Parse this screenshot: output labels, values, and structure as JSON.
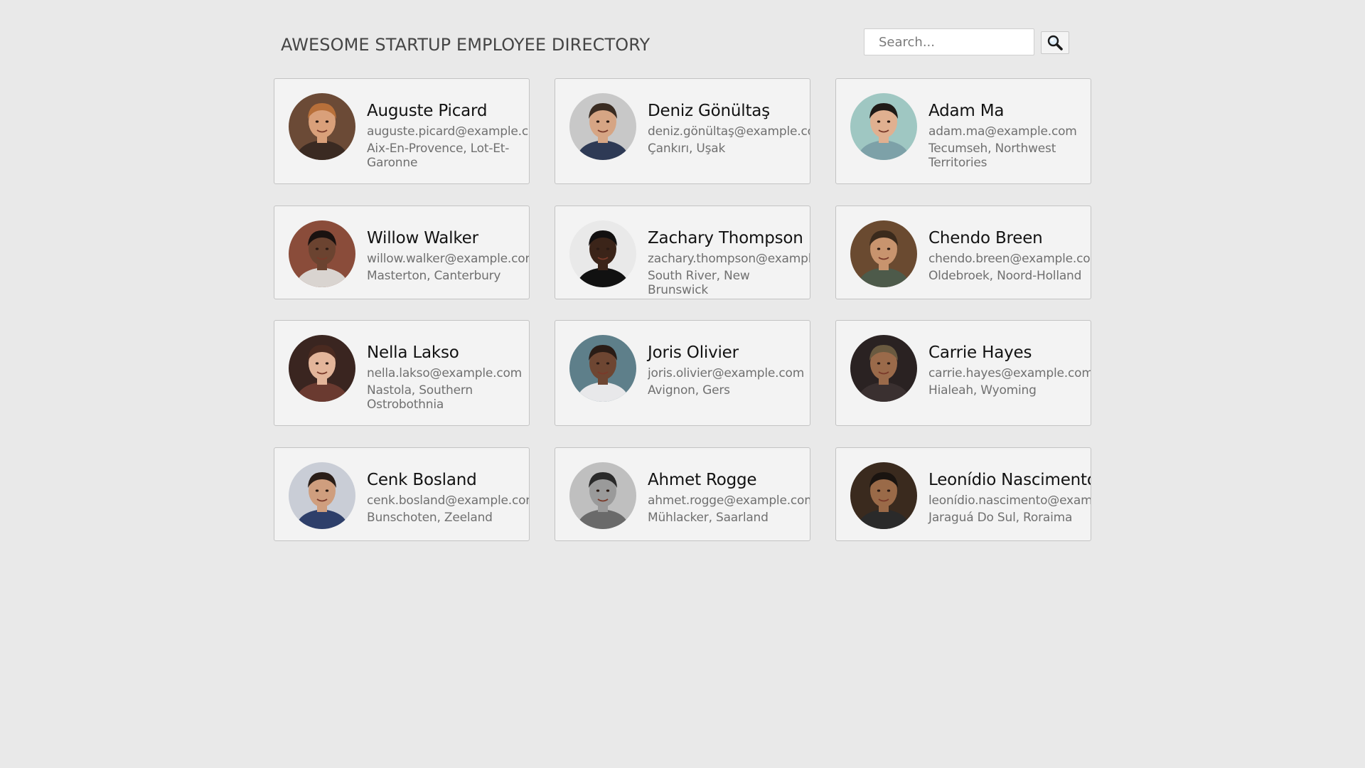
{
  "header": {
    "title": "AWESOME STARTUP EMPLOYEE DIRECTORY",
    "search_placeholder": "Search...",
    "search_value": "",
    "search_button_icon": "magnifier-icon"
  },
  "employees": [
    {
      "name": "Auguste Picard",
      "email": "auguste.picard@example.com",
      "location": "Aix-En-Provence, Lot-Et-Garonne",
      "avatar": {
        "bg": "#6b4a36",
        "skin": "#d9a07a",
        "hair": "#b8703a",
        "shirt": "#3a2a22"
      }
    },
    {
      "name": "Deniz Gönültaş",
      "email": "deniz.gönültaş@example.com",
      "location": "Çankırı, Uşak",
      "avatar": {
        "bg": "#c8c8c8",
        "skin": "#d6a584",
        "hair": "#3a2c22",
        "shirt": "#2e3a55"
      }
    },
    {
      "name": "Adam Ma",
      "email": "adam.ma@example.com",
      "location": "Tecumseh, Northwest Territories",
      "avatar": {
        "bg": "#9fc7c2",
        "skin": "#e0b090",
        "hair": "#1f1a17",
        "shirt": "#7da1a8"
      }
    },
    {
      "name": "Willow Walker",
      "email": "willow.walker@example.com",
      "location": "Masterton, Canterbury",
      "avatar": {
        "bg": "#8a4c3a",
        "skin": "#6b4330",
        "hair": "#1a1210",
        "shirt": "#d9d4d0"
      }
    },
    {
      "name": "Zachary Thompson",
      "email": "zachary.thompson@example.com",
      "location": "South River, New Brunswick",
      "avatar": {
        "bg": "#e9e9e9",
        "skin": "#3b2419",
        "hair": "#121010",
        "shirt": "#111111"
      }
    },
    {
      "name": "Chendo Breen",
      "email": "chendo.breen@example.com",
      "location": "Oldebroek, Noord-Holland",
      "avatar": {
        "bg": "#6a4a30",
        "skin": "#c8946e",
        "hair": "#3a2a1c",
        "shirt": "#4d5a4a"
      }
    },
    {
      "name": "Nella Lakso",
      "email": "nella.lakso@example.com",
      "location": "Nastola, Southern Ostrobothnia",
      "avatar": {
        "bg": "#3a2520",
        "skin": "#e3b59a",
        "hair": "#4a2a20",
        "shirt": "#6a3a30"
      }
    },
    {
      "name": "Joris Olivier",
      "email": "joris.olivier@example.com",
      "location": "Avignon, Gers",
      "avatar": {
        "bg": "#5e7f8a",
        "skin": "#6e4632",
        "hair": "#2a1c16",
        "shirt": "#e8e8ea"
      }
    },
    {
      "name": "Carrie Hayes",
      "email": "carrie.hayes@example.com",
      "location": "Hialeah, Wyoming",
      "avatar": {
        "bg": "#2a2222",
        "skin": "#9a6a4a",
        "hair": "#6a5a40",
        "shirt": "#3a3030"
      }
    },
    {
      "name": "Cenk Bosland",
      "email": "cenk.bosland@example.com",
      "location": "Bunschoten, Zeeland",
      "avatar": {
        "bg": "#c9cdd6",
        "skin": "#cf9e7e",
        "hair": "#2a1e18",
        "shirt": "#2e3f6a"
      }
    },
    {
      "name": "Ahmet Rogge",
      "email": "ahmet.rogge@example.com",
      "location": "Mühlacker, Saarland",
      "avatar": {
        "bg": "#bfbfbf",
        "skin": "#9a9a9a",
        "hair": "#2a2a2a",
        "shirt": "#6a6a6a"
      }
    },
    {
      "name": "Leonídio Nascimento",
      "email": "leonídio.nascimento@example.com",
      "location": "Jaraguá Do Sul, Roraima",
      "avatar": {
        "bg": "#3a2a1e",
        "skin": "#9a6a48",
        "hair": "#1a1410",
        "shirt": "#2a2a2a"
      }
    }
  ]
}
